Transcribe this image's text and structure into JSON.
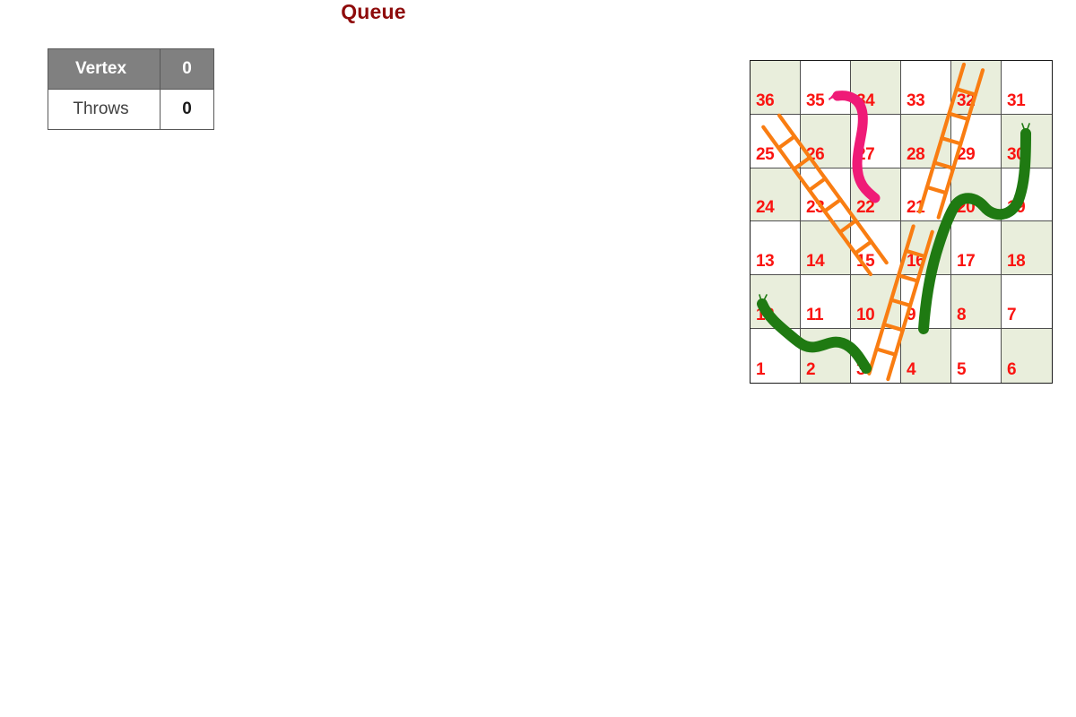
{
  "title": "Queue",
  "status": {
    "rows": [
      {
        "label": "Vertex",
        "value": "0"
      },
      {
        "label": "Throws",
        "value": "0"
      }
    ]
  },
  "board": {
    "rows": 6,
    "cols": 6,
    "numbers": [
      [
        36,
        35,
        34,
        33,
        32,
        31
      ],
      [
        25,
        26,
        27,
        28,
        29,
        30
      ],
      [
        24,
        23,
        22,
        21,
        20,
        19
      ],
      [
        13,
        14,
        15,
        16,
        17,
        18
      ],
      [
        12,
        11,
        10,
        9,
        8,
        7
      ],
      [
        1,
        2,
        3,
        4,
        5,
        6
      ]
    ],
    "shaded": [
      [
        true,
        false,
        true,
        false,
        true,
        false
      ],
      [
        false,
        true,
        false,
        true,
        false,
        true
      ],
      [
        true,
        false,
        true,
        false,
        true,
        false
      ],
      [
        false,
        true,
        false,
        true,
        false,
        true
      ],
      [
        true,
        false,
        true,
        false,
        true,
        false
      ],
      [
        false,
        true,
        false,
        true,
        false,
        true
      ]
    ],
    "colors": {
      "shaded_cell": "#e9eedc",
      "plain_cell": "#ffffff",
      "number": "#fa1411",
      "grid_line": "#4f4f4f",
      "border": "#1a1a1a",
      "ladder": "#f97d12",
      "snake_pink": "#ef1b77",
      "snake_green": "#1f7a12"
    },
    "snakes": [
      {
        "name": "snake-35-to-22",
        "from": 35,
        "to": 22,
        "color": "#ef1b77"
      },
      {
        "name": "snake-30-to-4",
        "from": 30,
        "to": 4,
        "color": "#1f7a12"
      },
      {
        "name": "snake-12-to-2",
        "from": 12,
        "to": 2,
        "color": "#1f7a12"
      }
    ],
    "ladders": [
      {
        "name": "ladder-15-to-25",
        "from": 15,
        "to": 25,
        "color": "#f97d12"
      },
      {
        "name": "ladder-3-to-16",
        "from": 3,
        "to": 16,
        "color": "#f97d12"
      },
      {
        "name": "ladder-21-to-32",
        "from": 21,
        "to": 32,
        "color": "#f97d12"
      }
    ]
  }
}
